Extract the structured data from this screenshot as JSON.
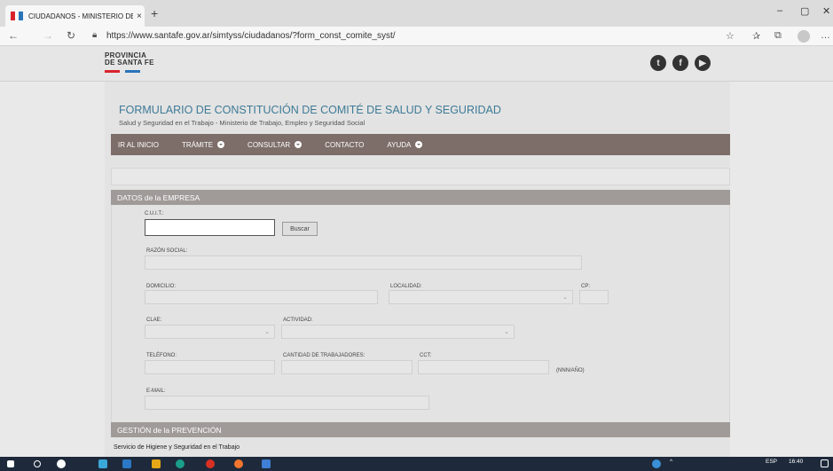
{
  "browser": {
    "tab_title": "CIUDADANOS - MINISTERIO DE",
    "tab_close": "×",
    "new_tab": "+",
    "url": "https://www.santafe.gov.ar/simtyss/ciudadanos/?form_const_comite_syst/",
    "win_minimize": "–",
    "win_maximize": "▢",
    "win_close": "✕"
  },
  "site": {
    "logo_line1": "PROVINCIA",
    "logo_line2": "DE SANTA FE",
    "social": [
      "twitter-icon",
      "facebook-icon",
      "youtube-icon"
    ],
    "colors": {
      "logo_red": "#d9232d",
      "logo_blue": "#2a74b8",
      "menu_bg": "#7d6e69",
      "section_bar": "#a09a98",
      "title": "#3d7a96"
    }
  },
  "form": {
    "title": "FORMULARIO DE CONSTITUCIÓN DE COMITÉ DE SALUD Y SEGURIDAD",
    "subtitle": "Salud y Seguridad en el Trabajo - Ministerio de Trabajo, Empleo y Seguridad Social"
  },
  "menu": {
    "items": [
      {
        "label": "IR AL INICIO",
        "has_dropdown": false
      },
      {
        "label": "TRÁMITE",
        "has_dropdown": true
      },
      {
        "label": "CONSULTAR",
        "has_dropdown": true
      },
      {
        "label": "CONTACTO",
        "has_dropdown": false
      },
      {
        "label": "AYUDA",
        "has_dropdown": true
      }
    ]
  },
  "empresa": {
    "section_title": "DATOS de la EMPRESA",
    "cuit_label": "C.U.I.T.:",
    "cuit_value": "",
    "buscar_label": "Buscar",
    "razon_social_label": "RAZÓN SOCIAL:",
    "domicilio_label": "DOMICILIO:",
    "localidad_label": "LOCALIDAD:",
    "cp_label": "CP:",
    "clae_label": "CLAE:",
    "actividad_label": "ACTIVIDAD:",
    "telefono_label": "TELÉFONO:",
    "trabajadores_label": "CANTIDAD DE TRABAJADORES:",
    "cct_label": "CCT:",
    "cct_hint": "(NNN/AÑO)",
    "email_label": "E-MAIL:"
  },
  "prevencion": {
    "section_title": "GESTIÓN de la PREVENCIÓN",
    "higiene_label": "Servicio de Higiene y Seguridad en el Trabajo"
  },
  "taskbar": {
    "lang": "ESP",
    "time": "16:40"
  }
}
